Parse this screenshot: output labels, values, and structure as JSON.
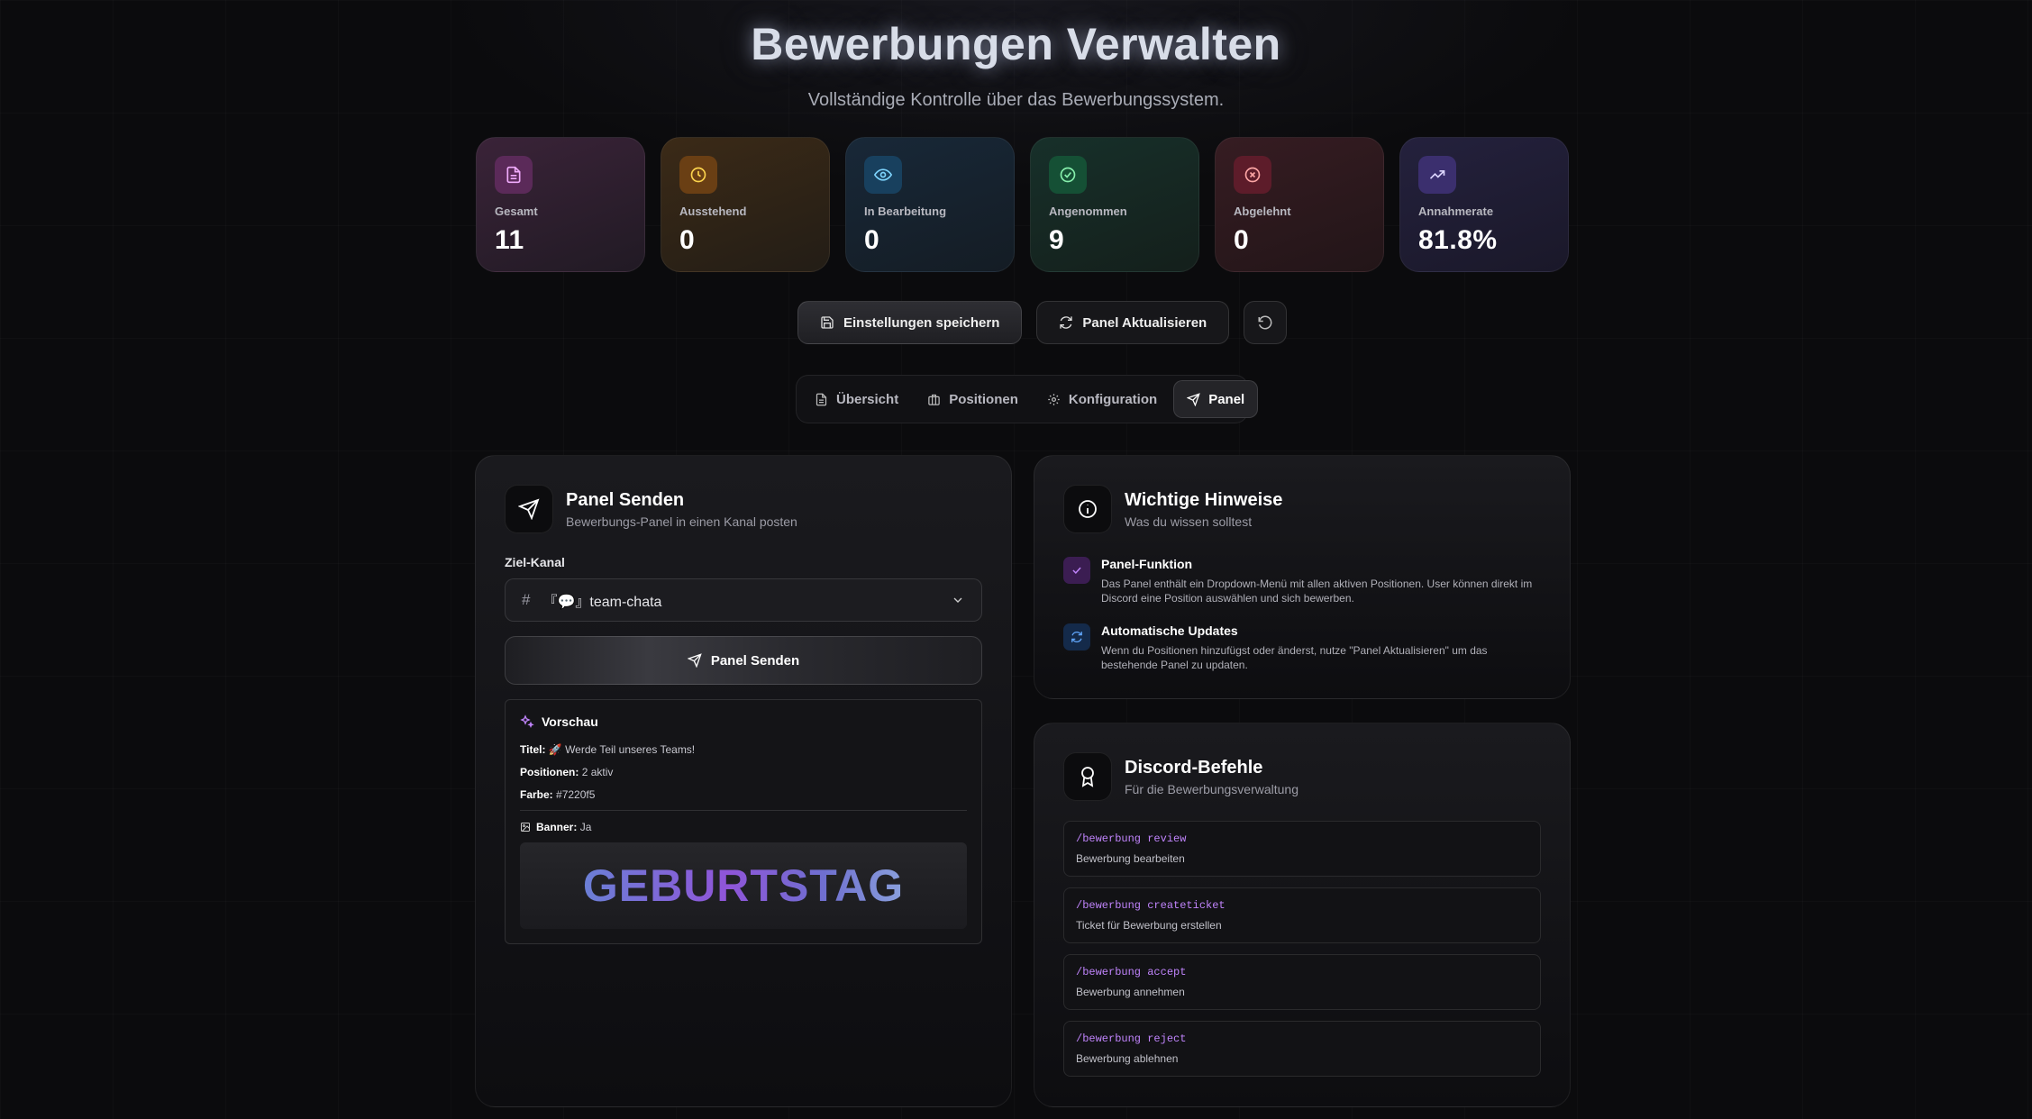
{
  "header": {
    "title": "Bewerbungen Verwalten",
    "subtitle": "Vollständige Kontrolle über das Bewerbungssystem."
  },
  "stats": [
    {
      "label": "Gesamt",
      "value": "11",
      "icon": "document-icon",
      "color": "#e879f9"
    },
    {
      "label": "Ausstehend",
      "value": "0",
      "icon": "clock-icon",
      "color": "#fbbf24"
    },
    {
      "label": "In Bearbeitung",
      "value": "0",
      "icon": "eye-icon",
      "color": "#7dd3fc"
    },
    {
      "label": "Angenommen",
      "value": "9",
      "icon": "check-circle-icon",
      "color": "#86efac"
    },
    {
      "label": "Abgelehnt",
      "value": "0",
      "icon": "x-circle-icon",
      "color": "#fca5a5"
    },
    {
      "label": "Annahmerate",
      "value": "81.8%",
      "icon": "trending-up-icon",
      "color": "#c4b5fd"
    }
  ],
  "actions": {
    "save_label": "Einstellungen speichern",
    "refresh_panel_label": "Panel Aktualisieren"
  },
  "tabs": [
    {
      "label": "Übersicht",
      "icon": "document-icon"
    },
    {
      "label": "Positionen",
      "icon": "briefcase-icon"
    },
    {
      "label": "Konfiguration",
      "icon": "gear-icon"
    },
    {
      "label": "Panel",
      "icon": "send-icon",
      "active": true
    }
  ],
  "panel_send": {
    "title": "Panel Senden",
    "subtitle": "Bewerbungs-Panel in einen Kanal posten",
    "channel_label": "Ziel-Kanal",
    "channel_value": "『💬』team-chata",
    "send_label": "Panel Senden",
    "preview": {
      "heading": "Vorschau",
      "title_label": "Titel:",
      "title_value": "🚀 Werde Teil unseres Teams!",
      "positions_label": "Positionen:",
      "positions_value": "2 aktiv",
      "color_label": "Farbe:",
      "color_value": "#7220f5",
      "banner_label": "Banner:",
      "banner_value": "Ja",
      "banner_text": "GEBURTSTAG"
    }
  },
  "hints": {
    "title": "Wichtige Hinweise",
    "subtitle": "Was du wissen solltest",
    "items": [
      {
        "title": "Panel-Funktion",
        "text": "Das Panel enthält ein Dropdown-Menü mit allen aktiven Positionen. User können direkt im Discord eine Position auswählen und sich bewerben."
      },
      {
        "title": "Automatische Updates",
        "text": "Wenn du Positionen hinzufügst oder änderst, nutze \"Panel Aktualisieren\" um das bestehende Panel zu updaten."
      }
    ]
  },
  "commands": {
    "title": "Discord-Befehle",
    "subtitle": "Für die Bewerbungsverwaltung",
    "items": [
      {
        "command": "/bewerbung review",
        "desc": "Bewerbung bearbeiten"
      },
      {
        "command": "/bewerbung createticket",
        "desc": "Ticket für Bewerbung erstellen"
      },
      {
        "command": "/bewerbung accept",
        "desc": "Bewerbung annehmen"
      },
      {
        "command": "/bewerbung reject",
        "desc": "Bewerbung ablehnen"
      }
    ]
  }
}
